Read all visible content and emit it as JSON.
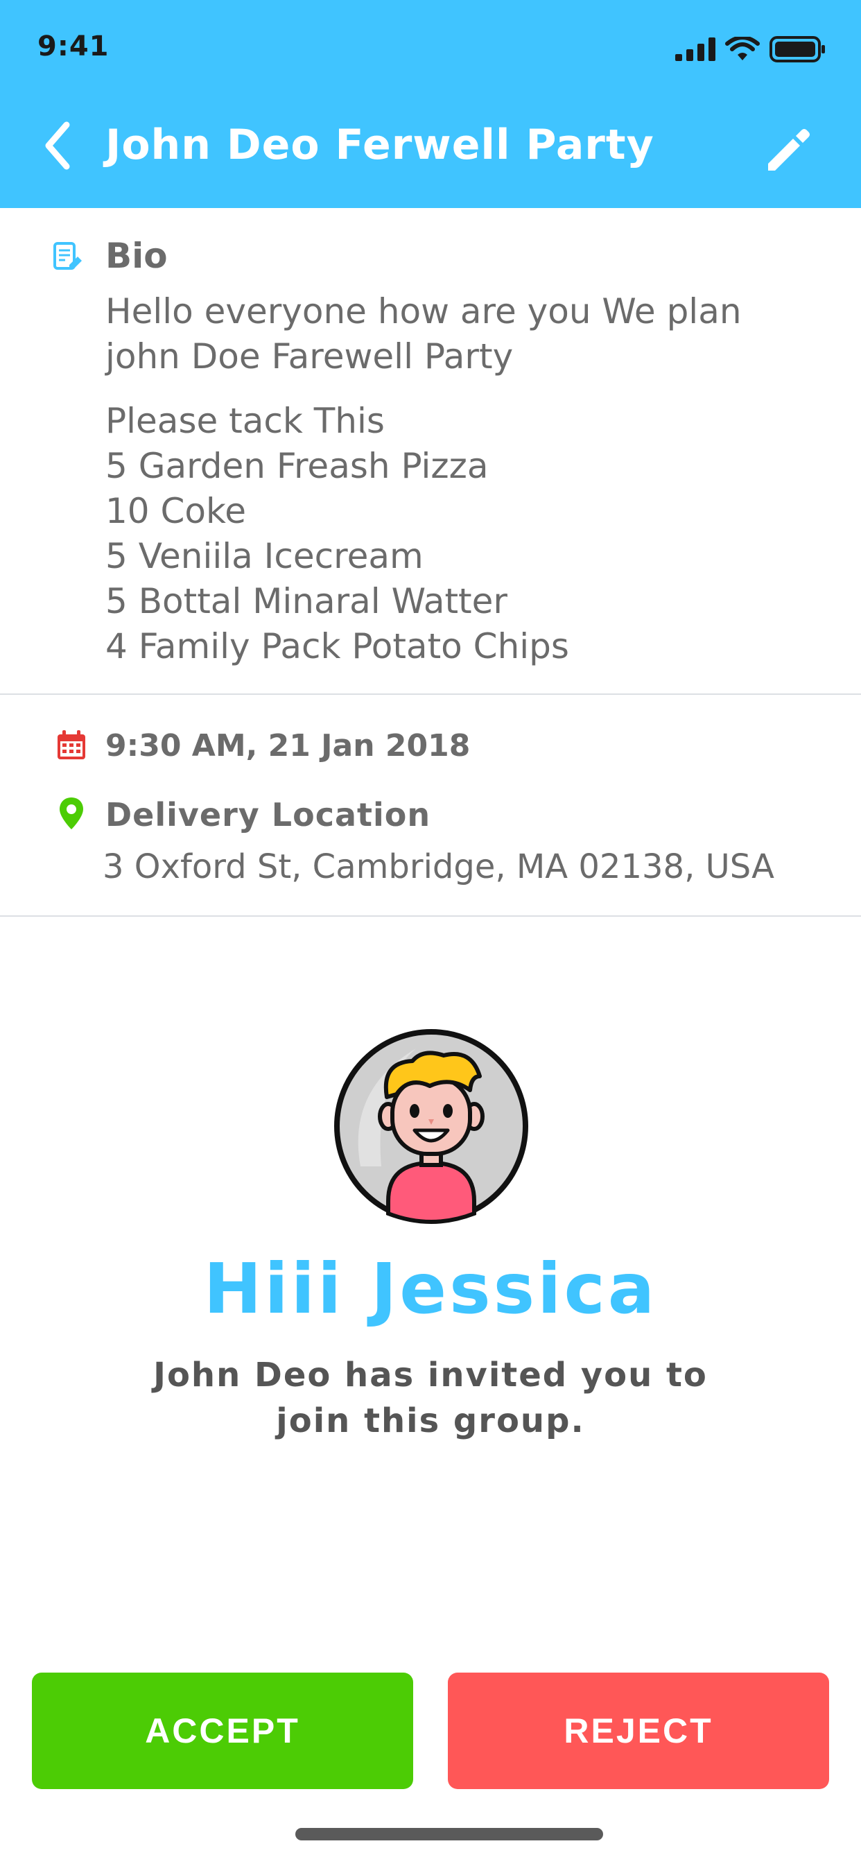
{
  "status_bar": {
    "time": "9:41"
  },
  "header": {
    "title": "John Deo Ferwell Party"
  },
  "bio": {
    "label": "Bio",
    "intro_lines": [
      "Hello everyone how are you We plan",
      "john Doe Farewell Party"
    ],
    "list_lines": [
      "Please tack  This",
      "5 Garden Freash Pizza",
      "10 Coke",
      "5 Veniila Icecream",
      "5 Bottal Minaral Watter",
      "4 Family Pack Potato Chips"
    ]
  },
  "event": {
    "datetime": "9:30 AM, 21 Jan 2018",
    "location_label": "Delivery Location",
    "address": "3 Oxford St, Cambridge, MA 02138, USA"
  },
  "invitation": {
    "greeting": "Hiii Jessica",
    "message_lines": [
      "John Deo has invited you to",
      "join this group."
    ]
  },
  "actions": {
    "accept_label": "ACCEPT",
    "reject_label": "REJECT"
  },
  "colors": {
    "header": "#40c4ff",
    "accent": "#40c4ff",
    "accept": "#4ccc05",
    "reject": "#ff5757",
    "calendar_icon": "#e53935",
    "location_icon": "#4ccc05"
  },
  "icons": {
    "back": "chevron-left-icon",
    "edit": "pencil-icon",
    "bio": "note-edit-icon",
    "date": "calendar-icon",
    "location": "map-pin-icon"
  }
}
